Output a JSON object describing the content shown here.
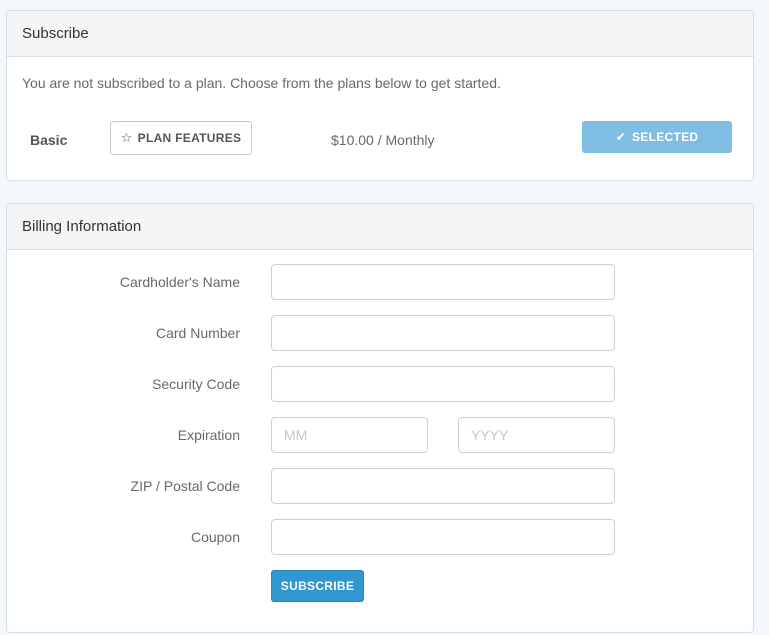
{
  "subscribe_panel": {
    "title": "Subscribe",
    "intro": "You are not subscribed to a plan. Choose from the plans below to get started.",
    "plan": {
      "name": "Basic",
      "features_label": "PLAN FEATURES",
      "features_icon": "star-outline-icon",
      "price": "$10.00 / Monthly",
      "selected_label": "SELECTED",
      "selected_icon": "check-icon",
      "selected_color": "#7fbde2"
    }
  },
  "billing_panel": {
    "title": "Billing Information",
    "fields": {
      "cardholder_name": {
        "label": "Cardholder's Name",
        "value": "",
        "placeholder": ""
      },
      "card_number": {
        "label": "Card Number",
        "value": "",
        "placeholder": ""
      },
      "security_code": {
        "label": "Security Code",
        "value": "",
        "placeholder": ""
      },
      "expiration": {
        "label": "Expiration",
        "month_placeholder": "MM",
        "year_placeholder": "YYYY"
      },
      "zip": {
        "label": "ZIP / Postal Code",
        "value": "",
        "placeholder": ""
      },
      "coupon": {
        "label": "Coupon",
        "value": "",
        "placeholder": ""
      }
    },
    "submit_label": "SUBSCRIBE",
    "submit_color": "#3097d1"
  }
}
